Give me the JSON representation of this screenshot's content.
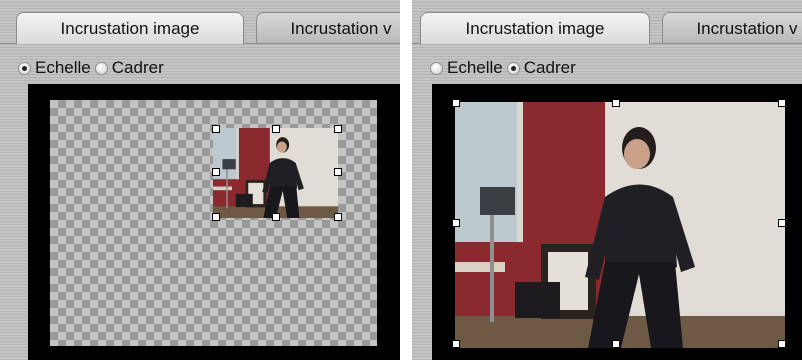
{
  "left_panel": {
    "tabs": [
      {
        "label": "Incrustation image",
        "active": true
      },
      {
        "label": "Incrustation v",
        "active": false
      }
    ],
    "radios": [
      {
        "label": "Echelle",
        "checked": true
      },
      {
        "label": "Cadrer",
        "checked": false
      }
    ]
  },
  "right_panel": {
    "tabs": [
      {
        "label": "Incrustation image",
        "active": true
      },
      {
        "label": "Incrustation v",
        "active": false
      }
    ],
    "radios": [
      {
        "label": "Echelle",
        "checked": false
      },
      {
        "label": "Cadrer",
        "checked": true
      }
    ]
  },
  "colors": {
    "panel_bg": "#c0c0c0",
    "preview_bg": "#000000",
    "checker_light": "#c3c3c3",
    "checker_dark": "#9a9a9a",
    "wall_red": "#8a2a2e",
    "backdrop": "#e2dcd6"
  }
}
